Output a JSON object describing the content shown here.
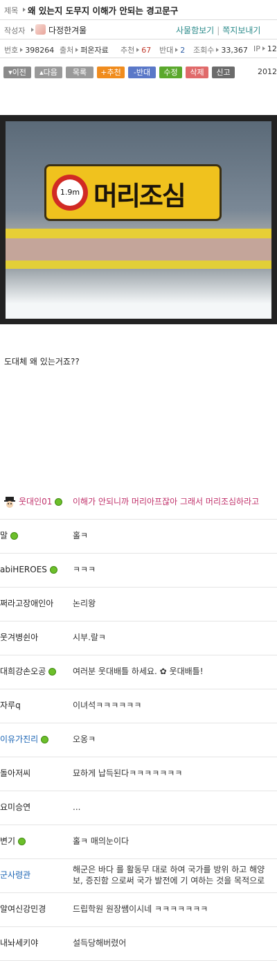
{
  "post": {
    "title_label": "제목",
    "title": "왜 있는지 도무지 이해가 안되는 경고문구",
    "author_label": "작성자",
    "author": "다정한겨울",
    "links": [
      "사물함보기",
      "쪽지보내기"
    ],
    "meta": {
      "number_label": "번호",
      "number": "398264",
      "source_label": "출처",
      "source": "퍼온자료",
      "recommend_label": "추천",
      "recommend": "67",
      "oppose_label": "반대",
      "oppose": "2",
      "views_label": "조회수",
      "views": "33,367",
      "ip_label": "IP",
      "ip": "12"
    },
    "buttons": {
      "prev": "이전",
      "next": "다음",
      "list": "목록",
      "recommend": "추천",
      "oppose": "반대",
      "edit": "수정",
      "delete": "삭제",
      "report": "신고"
    },
    "date": "2012-",
    "sign_text": "머리조심",
    "sign_badge": "1.9m",
    "body": "도대체 왜 있는거죠??"
  },
  "colors": {
    "btn_gray": "#8a8a8a",
    "btn_orange": "#f08c1e",
    "btn_blue": "#5a78c8",
    "btn_green": "#5aa82c",
    "btn_red": "#e06a6a",
    "btn_dark": "#6b6b6b",
    "link_teal": "#2a8a8a",
    "nick_pink": "#c0306a"
  },
  "comments": [
    {
      "nick": "웃대인01",
      "text": "이해가 안되니까 머리아프잖아 그래서 머리조심하라고",
      "online": true,
      "level_icon": true,
      "nick_color": "red",
      "text_color": "red"
    },
    {
      "nick": "말",
      "text": "홀ㅋ",
      "online": true
    },
    {
      "nick": "abiHEROES",
      "text": "ㅋㅋㅋ",
      "online": true
    },
    {
      "nick": "쩌라고장애인아",
      "text": "논리왕",
      "online": false
    },
    {
      "nick": "웃겨병쉰아",
      "text": "시부.랄ㅋ",
      "online": false
    },
    {
      "nick": "대희강손오공",
      "text": "여러분 웃대배틀 하세요. ✿ 웃대배틀!",
      "online": true
    },
    {
      "nick": "자루q",
      "text": "이녀석ㅋㅋㅋㅋㅋㅋ",
      "online": false
    },
    {
      "nick": "이유가진리",
      "text": "오옹ㅋ",
      "online": true,
      "nick_color": "blue"
    },
    {
      "nick": "돌아저씨",
      "text": "묘하게 납득된다ㅋㅋㅋㅋㅋㅋㅋ",
      "online": false
    },
    {
      "nick": "요미승연",
      "text": "...",
      "online": false
    },
    {
      "nick": "변기",
      "text": "홀ㅋ 매의눈이다",
      "online": true
    },
    {
      "nick": "군사령관",
      "text": "해군은 바다 를 활동무 대로 하여 국가를 방위 하고 해양 보, 증진함 으로써 국가 발전에 기 여하는 것을 목적으로",
      "online": false,
      "nick_color": "blue",
      "two_line": true
    },
    {
      "nick": "알여신강민경",
      "text": "드립학원 원장쌤이시네 ㅋㅋㅋㅋㅋㅋㅋ",
      "online": false
    },
    {
      "nick": "내놔세키야",
      "text": "설득당해버렸어",
      "online": false
    }
  ]
}
